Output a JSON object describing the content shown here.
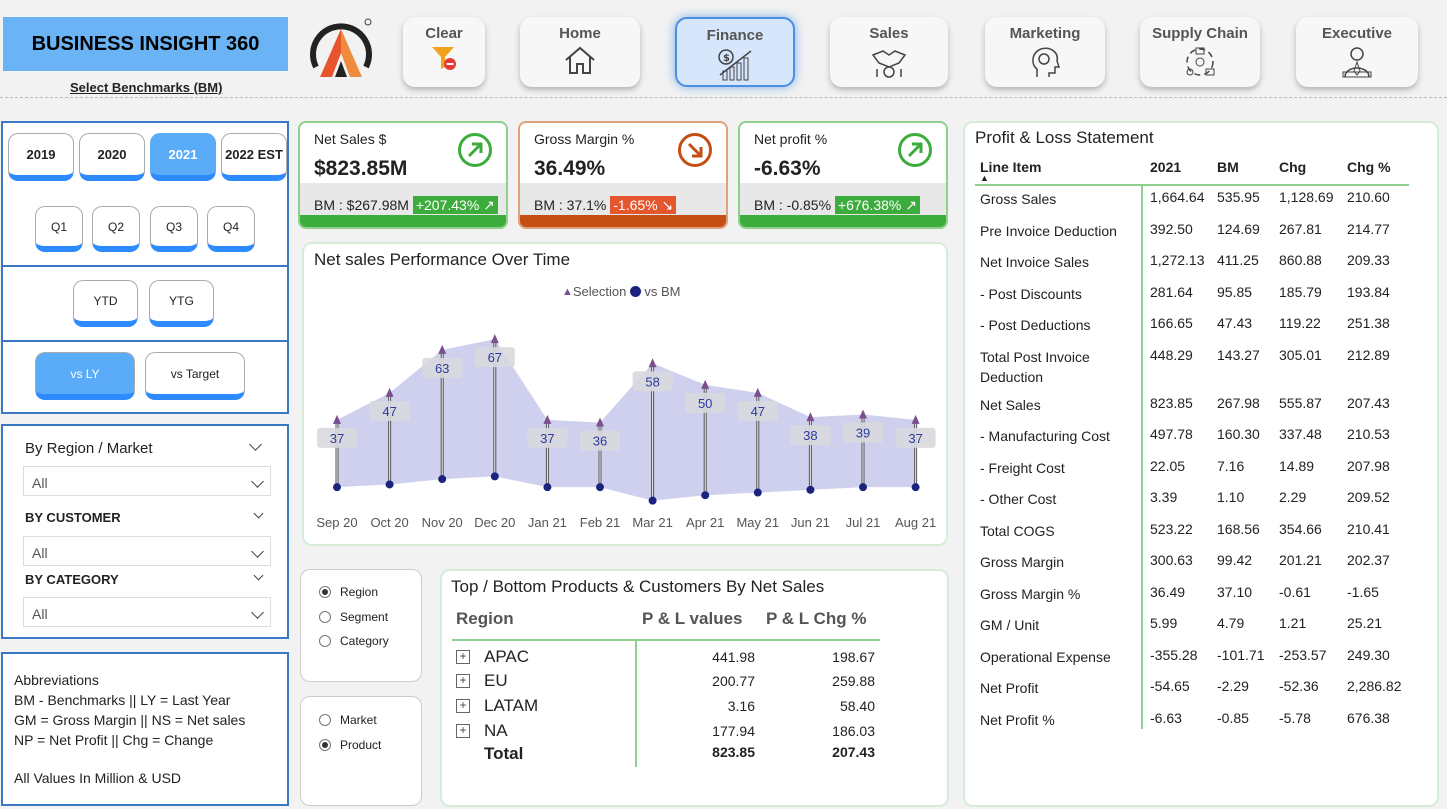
{
  "header": {
    "title": "BUSINESS INSIGHT 360",
    "benchmark_link": "Select Benchmarks (BM)",
    "nav": [
      {
        "label": "Clear",
        "icon": "filter-clear-icon"
      },
      {
        "label": "Home",
        "icon": "home-icon"
      },
      {
        "label": "Finance",
        "icon": "finance-chart-icon",
        "active": true
      },
      {
        "label": "Sales",
        "icon": "sales-handshake-icon"
      },
      {
        "label": "Marketing",
        "icon": "marketing-head-icon"
      },
      {
        "label": "Supply Chain",
        "icon": "supply-chain-icon"
      },
      {
        "label": "Executive",
        "icon": "executive-icon"
      }
    ]
  },
  "filters": {
    "years": [
      "2019",
      "2020",
      "2021",
      "2022 EST"
    ],
    "selected_year": "2021",
    "quarters": [
      "Q1",
      "Q2",
      "Q3",
      "Q4"
    ],
    "periods": [
      "YTD",
      "YTG"
    ],
    "compare": [
      "vs LY",
      "vs Target"
    ],
    "selected_compare": "vs LY",
    "region_label": "By Region / Market",
    "region_value": "All",
    "customer_label": "BY CUSTOMER",
    "customer_value": "All",
    "category_label": "BY CATEGORY",
    "category_value": "All"
  },
  "abbreviations": {
    "title": "Abbreviations",
    "line1": "BM - Benchmarks ||  LY = Last Year",
    "line2": "GM = Gross Margin || NS = Net sales",
    "line3": "NP = Net Profit || Chg = Change",
    "note": "All Values In Million & USD"
  },
  "kpis": [
    {
      "title": "Net Sales $",
      "value": "$823.85M",
      "bm": "BM : $267.98M",
      "chg": "+207.43%",
      "arrow": "↗",
      "color": "#3cac3c"
    },
    {
      "title": "Gross Margin %",
      "value": "36.49%",
      "bm": "BM : 37.1%",
      "chg": "-1.65%",
      "arrow": "↘",
      "color": "#c54e14"
    },
    {
      "title": "Net profit %",
      "value": "-6.63%",
      "bm": "BM : -0.85%",
      "chg": "+676.38%",
      "arrow": "↗",
      "color": "#3cac3c"
    }
  ],
  "chart_data": {
    "type": "line",
    "title": "Net sales Performance Over Time",
    "legend": [
      "Selection",
      "vs  BM"
    ],
    "legend_position": "top-center",
    "categories": [
      "Sep 20",
      "Oct 20",
      "Nov 20",
      "Dec 20",
      "Jan 21",
      "Feb 21",
      "Mar 21",
      "Apr 21",
      "May 21",
      "Jun 21",
      "Jul 21",
      "Aug 21"
    ],
    "series": [
      {
        "name": "Selection",
        "values": [
          37,
          47,
          63,
          67,
          37,
          36,
          58,
          50,
          47,
          38,
          39,
          37
        ]
      },
      {
        "name": "vs  BM",
        "values": [
          12,
          13,
          15,
          16,
          12,
          12,
          7,
          9,
          10,
          11,
          12,
          12
        ]
      }
    ],
    "data_labels": [
      "37",
      "47",
      "63",
      "67",
      "37",
      "36",
      "58",
      "50",
      "47",
      "38",
      "39",
      "37"
    ],
    "grid": false,
    "colors": {
      "selection": "#7b4f8e",
      "bm": "#1a237e",
      "band": "#c5c8ea"
    }
  },
  "view_toggle": {
    "options1": [
      "Region",
      "Segment",
      "Category"
    ],
    "selected1": "Region",
    "options2": [
      "Market",
      "Product"
    ],
    "selected2": "Product"
  },
  "products_table": {
    "title": "Top / Bottom Products & Customers By Net Sales",
    "headers": [
      "Region",
      "P & L values",
      "P & L Chg %"
    ],
    "rows": [
      [
        "APAC",
        "441.98",
        "198.67"
      ],
      [
        "EU",
        "200.77",
        "259.88"
      ],
      [
        "LATAM",
        "3.16",
        "58.40"
      ],
      [
        "NA",
        "177.94",
        "186.03"
      ]
    ],
    "total": [
      "Total",
      "823.85",
      "207.43"
    ]
  },
  "pl": {
    "title": "Profit & Loss Statement",
    "headers": [
      "Line Item",
      "2021",
      "BM",
      "Chg",
      "Chg %"
    ],
    "rows": [
      [
        "Gross Sales",
        "1,664.64",
        "535.95",
        "1,128.69",
        "210.60"
      ],
      [
        "Pre Invoice Deduction",
        "392.50",
        "124.69",
        "267.81",
        "214.77"
      ],
      [
        "Net Invoice Sales",
        "1,272.13",
        "411.25",
        "860.88",
        "209.33"
      ],
      [
        "- Post Discounts",
        "281.64",
        "95.85",
        "185.79",
        "193.84"
      ],
      [
        "- Post Deductions",
        "166.65",
        "47.43",
        "119.22",
        "251.38"
      ],
      [
        "Total Post Invoice Deduction",
        "448.29",
        "143.27",
        "305.01",
        "212.89"
      ],
      [
        "Net Sales",
        "823.85",
        "267.98",
        "555.87",
        "207.43"
      ],
      [
        "- Manufacturing Cost",
        "497.78",
        "160.30",
        "337.48",
        "210.53"
      ],
      [
        "- Freight Cost",
        "22.05",
        "7.16",
        "14.89",
        "207.98"
      ],
      [
        "- Other Cost",
        "3.39",
        "1.10",
        "2.29",
        "209.52"
      ],
      [
        "Total COGS",
        "523.22",
        "168.56",
        "354.66",
        "210.41"
      ],
      [
        "Gross Margin",
        "300.63",
        "99.42",
        "201.21",
        "202.37"
      ],
      [
        "Gross Margin %",
        "36.49",
        "37.10",
        "-0.61",
        "-1.65"
      ],
      [
        "GM / Unit",
        "5.99",
        "4.79",
        "1.21",
        "25.21"
      ],
      [
        "Operational Expense",
        "-355.28",
        "-101.71",
        "-253.57",
        "249.30"
      ],
      [
        "Net Profit",
        "-54.65",
        "-2.29",
        "-52.36",
        "2,286.82"
      ],
      [
        "Net Profit %",
        "-6.63",
        "-0.85",
        "-5.78",
        "676.38"
      ]
    ]
  }
}
